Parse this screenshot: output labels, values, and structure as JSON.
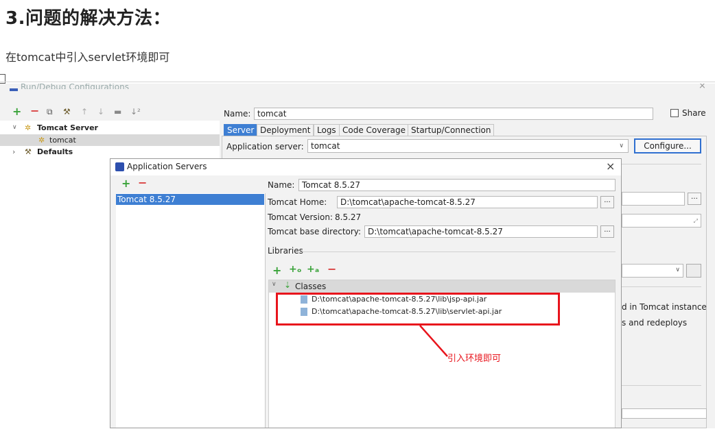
{
  "article": {
    "heading": "3.问题的解决方法：",
    "intro": "在tomcat中引入servlet环境即可"
  },
  "run_debug": {
    "title": "Run/Debug Configurations",
    "tree": {
      "tomcat_server": "Tomcat Server",
      "tomcat": "tomcat",
      "defaults": "Defaults"
    },
    "name_label": "Name:",
    "name_value": "tomcat",
    "share_label": "Share",
    "tabs": [
      "Server",
      "Deployment",
      "Logs",
      "Code Coverage",
      "Startup/Connection"
    ],
    "app_server_label": "Application server:",
    "app_server_value": "tomcat",
    "configure_button": "Configure...",
    "snippet_instance": "d in Tomcat instance",
    "snippet_redeploys": "s and redeploys"
  },
  "app_servers": {
    "title": "Application Servers",
    "list": [
      "Tomcat 8.5.27"
    ],
    "name_label": "Name:",
    "name_value": "Tomcat 8.5.27",
    "home_label": "Tomcat Home:",
    "home_value": "D:\\tomcat\\apache-tomcat-8.5.27",
    "version_label": "Tomcat Version:",
    "version_value": "8.5.27",
    "base_label": "Tomcat base directory:",
    "base_value": "D:\\tomcat\\apache-tomcat-8.5.27",
    "libraries_label": "Libraries",
    "classes_label": "Classes",
    "jars": [
      "D:\\tomcat\\apache-tomcat-8.5.27\\lib\\jsp-api.jar",
      "D:\\tomcat\\apache-tomcat-8.5.27\\lib\\servlet-api.jar"
    ],
    "browse_label": "..."
  },
  "annotation": {
    "text": "引入环境即可",
    "color": "#e8141c"
  },
  "colors": {
    "selection": "#3e7fd3",
    "add_green": "#3aa33a",
    "remove_red": "#d94040"
  }
}
